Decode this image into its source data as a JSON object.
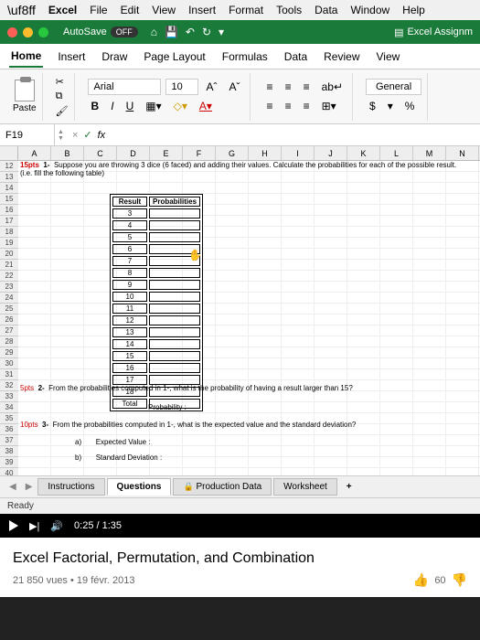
{
  "menubar": [
    "Excel",
    "File",
    "Edit",
    "View",
    "Insert",
    "Format",
    "Tools",
    "Data",
    "Window",
    "Help"
  ],
  "autosave": {
    "label": "AutoSave",
    "state": "OFF"
  },
  "doc_title": "Excel Assignm",
  "ribbon_tabs": [
    "Home",
    "Insert",
    "Draw",
    "Page Layout",
    "Formulas",
    "Data",
    "Review",
    "View"
  ],
  "ribbon": {
    "paste": "Paste",
    "font": "Arial",
    "size": "10",
    "grow": "Aˆ",
    "shrink": "Aˇ",
    "bold": "B",
    "italic": "I",
    "underline": "U",
    "number_format": "General",
    "currency": "$",
    "percent": "%"
  },
  "namebox": "F19",
  "fx": {
    "x": "×",
    "check": "✓",
    "fx": "fx"
  },
  "cols": [
    "A",
    "B",
    "C",
    "D",
    "E",
    "F",
    "G",
    "H",
    "I",
    "J",
    "K",
    "L",
    "M",
    "N"
  ],
  "rows_start": 12,
  "rows_end": 40,
  "q1": {
    "pts": "15pts",
    "num": "1-",
    "text": "Suppose you are throwing 3 dice (6 faced) and adding their values. Calculate the probabilities for each of the possible result. (i.e. fill the following table)"
  },
  "table": {
    "h1": "Result",
    "h2": "Probabilities",
    "vals": [
      "3",
      "4",
      "5",
      "6",
      "7",
      "8",
      "9",
      "10",
      "11",
      "12",
      "13",
      "14",
      "15",
      "16",
      "17",
      "18"
    ],
    "total": "Total"
  },
  "q2": {
    "pts": "5pts",
    "num": "2-",
    "text": "From the probabilities computed in 1-, what is the probability of having a result larger than 15?",
    "label": "Probability :"
  },
  "q3": {
    "pts": "10pts",
    "num": "3-",
    "text": "From the probabilities computed in 1-, what is the expected value and the standard deviation?",
    "a": "a)",
    "a_label": "Expected Value :",
    "b": "b)",
    "b_label": "Standard Deviation :"
  },
  "sheet_tabs": [
    "Instructions",
    "Questions",
    "Production Data",
    "Worksheet"
  ],
  "status": "Ready",
  "video": {
    "time": "0:25 / 1:35",
    "title": "Excel Factorial, Permutation, and Combination",
    "views": "21 850 vues",
    "date": "19 févr. 2013",
    "likes": "60"
  }
}
